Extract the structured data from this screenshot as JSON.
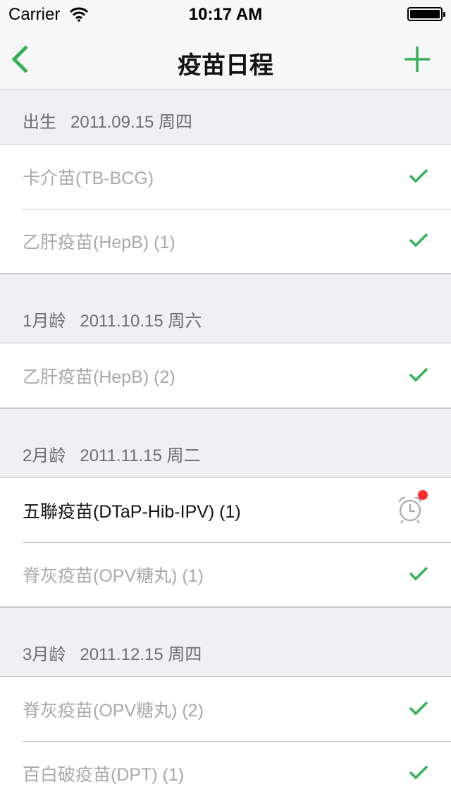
{
  "status_bar": {
    "carrier": "Carrier",
    "time": "10:17 AM"
  },
  "nav": {
    "title": "疫苗日程",
    "accent_color": "#34b157",
    "back_icon": "chevron-left-icon",
    "add_icon": "plus-icon"
  },
  "sections": [
    {
      "label": "出生",
      "date": "2011.09.15",
      "weekday": "周四",
      "items": [
        {
          "name": "卡介苗(TB-BCG)",
          "status": "done"
        },
        {
          "name": "乙肝疫苗(HepB) (1)",
          "status": "done"
        }
      ]
    },
    {
      "label": "1月龄",
      "date": "2011.10.15",
      "weekday": "周六",
      "items": [
        {
          "name": "乙肝疫苗(HepB) (2)",
          "status": "done"
        }
      ]
    },
    {
      "label": "2月龄",
      "date": "2011.11.15",
      "weekday": "周二",
      "items": [
        {
          "name": "五聯疫苗(DTaP-Hib-IPV) (1)",
          "status": "reminder"
        },
        {
          "name": "脊灰疫苗(OPV糖丸) (1)",
          "status": "done"
        }
      ]
    },
    {
      "label": "3月龄",
      "date": "2011.12.15",
      "weekday": "周四",
      "items": [
        {
          "name": "脊灰疫苗(OPV糖丸) (2)",
          "status": "done"
        },
        {
          "name": "百白破疫苗(DPT) (1)",
          "status": "done"
        }
      ]
    }
  ]
}
